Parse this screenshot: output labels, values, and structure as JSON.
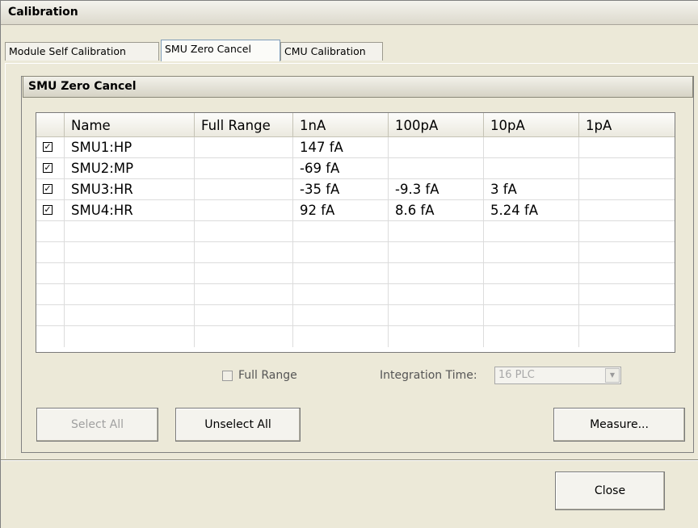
{
  "window": {
    "title": "Calibration"
  },
  "tabs": [
    {
      "label": "Module Self Calibration",
      "active": false
    },
    {
      "label": "SMU Zero Cancel",
      "active": true
    },
    {
      "label": "CMU Calibration",
      "active": false
    }
  ],
  "group": {
    "title": "SMU Zero Cancel"
  },
  "table": {
    "columns": [
      "",
      "Name",
      "Full Range",
      "1nA",
      "100pA",
      "10pA",
      "1pA"
    ],
    "rows": [
      {
        "checked": true,
        "name": "SMU1:HP",
        "full_range": "",
        "nA1": "147 fA",
        "pA100": "",
        "pA10": "",
        "pA1": ""
      },
      {
        "checked": true,
        "name": "SMU2:MP",
        "full_range": "",
        "nA1": "-69 fA",
        "pA100": "",
        "pA10": "",
        "pA1": ""
      },
      {
        "checked": true,
        "name": "SMU3:HR",
        "full_range": "",
        "nA1": "-35 fA",
        "pA100": "-9.3 fA",
        "pA10": "3 fA",
        "pA1": ""
      },
      {
        "checked": true,
        "name": "SMU4:HR",
        "full_range": "",
        "nA1": "92 fA",
        "pA100": "8.6 fA",
        "pA10": "5.24 fA",
        "pA1": ""
      }
    ],
    "check_glyph": "☑"
  },
  "options": {
    "full_range_label": "Full Range",
    "full_range_checked": false,
    "integration_time_label": "Integration Time:",
    "integration_time_value": "16 PLC"
  },
  "buttons": {
    "select_all": "Select All",
    "unselect_all": "Unselect All",
    "measure": "Measure...",
    "close": "Close"
  },
  "icons": {
    "dropdown": "chevron-down-icon",
    "checkbox": "checkbox-checked-icon"
  }
}
